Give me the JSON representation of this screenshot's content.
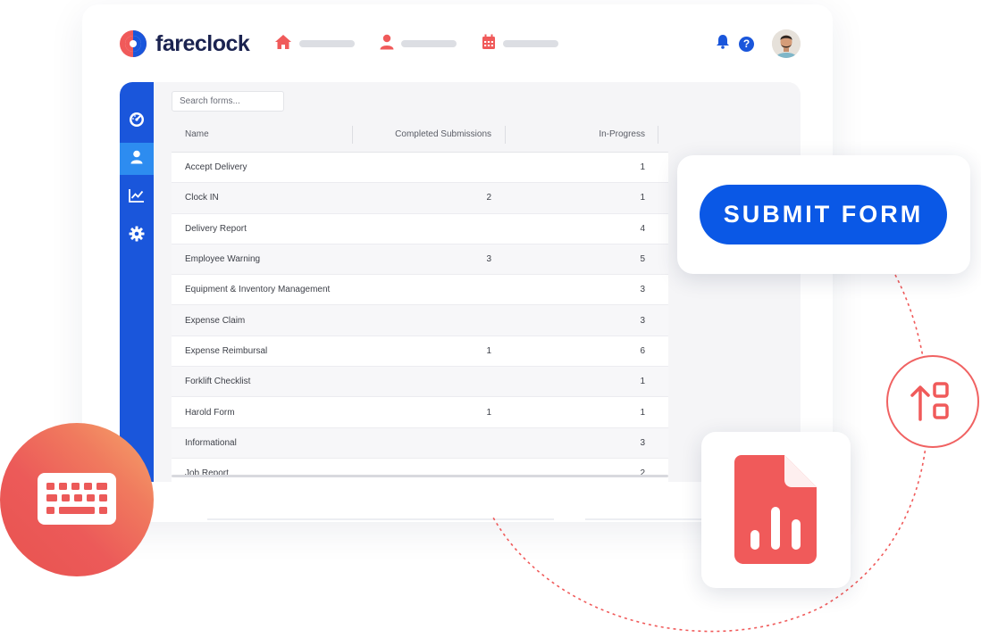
{
  "brand": {
    "name": "fareclock",
    "colors": {
      "primary": "#1a56db",
      "accent": "#f05a5a",
      "active": "#2d8cf0",
      "submit": "#0a58e6"
    }
  },
  "topnav": {
    "items": [
      {
        "icon": "home-icon"
      },
      {
        "icon": "user-icon"
      },
      {
        "icon": "calendar-icon"
      }
    ],
    "right": {
      "bell_icon": "bell-icon",
      "help_label": "?",
      "avatar_icon": "avatar"
    }
  },
  "sidebar": {
    "items": [
      {
        "icon": "dashboard-icon",
        "active": false
      },
      {
        "icon": "user-icon",
        "active": true
      },
      {
        "icon": "chart-icon",
        "active": false
      },
      {
        "icon": "gear-icon",
        "active": false
      }
    ]
  },
  "search": {
    "placeholder": "Search forms..."
  },
  "table": {
    "columns": [
      "Name",
      "Completed Submissions",
      "In-Progress"
    ],
    "rows": [
      {
        "name": "Accept Delivery",
        "completed": "",
        "in_progress": "1"
      },
      {
        "name": "Clock IN",
        "completed": "2",
        "in_progress": "1"
      },
      {
        "name": "Delivery Report",
        "completed": "",
        "in_progress": "4"
      },
      {
        "name": "Employee Warning",
        "completed": "3",
        "in_progress": "5"
      },
      {
        "name": "Equipment & Inventory Management",
        "completed": "",
        "in_progress": "3"
      },
      {
        "name": "Expense Claim",
        "completed": "",
        "in_progress": "3"
      },
      {
        "name": "Expense Reimbursal",
        "completed": "1",
        "in_progress": "6"
      },
      {
        "name": "Forklift Checklist",
        "completed": "",
        "in_progress": "1"
      },
      {
        "name": "Harold Form",
        "completed": "1",
        "in_progress": "1"
      },
      {
        "name": "Informational",
        "completed": "",
        "in_progress": "3"
      },
      {
        "name": "Job Report",
        "completed": "",
        "in_progress": "2"
      }
    ]
  },
  "submit": {
    "label": "SUBMIT FORM"
  },
  "decorations": {
    "report_icon": "report-file-icon",
    "upload_icon": "upload-shapes-icon",
    "keyboard_icon": "keyboard-icon"
  }
}
